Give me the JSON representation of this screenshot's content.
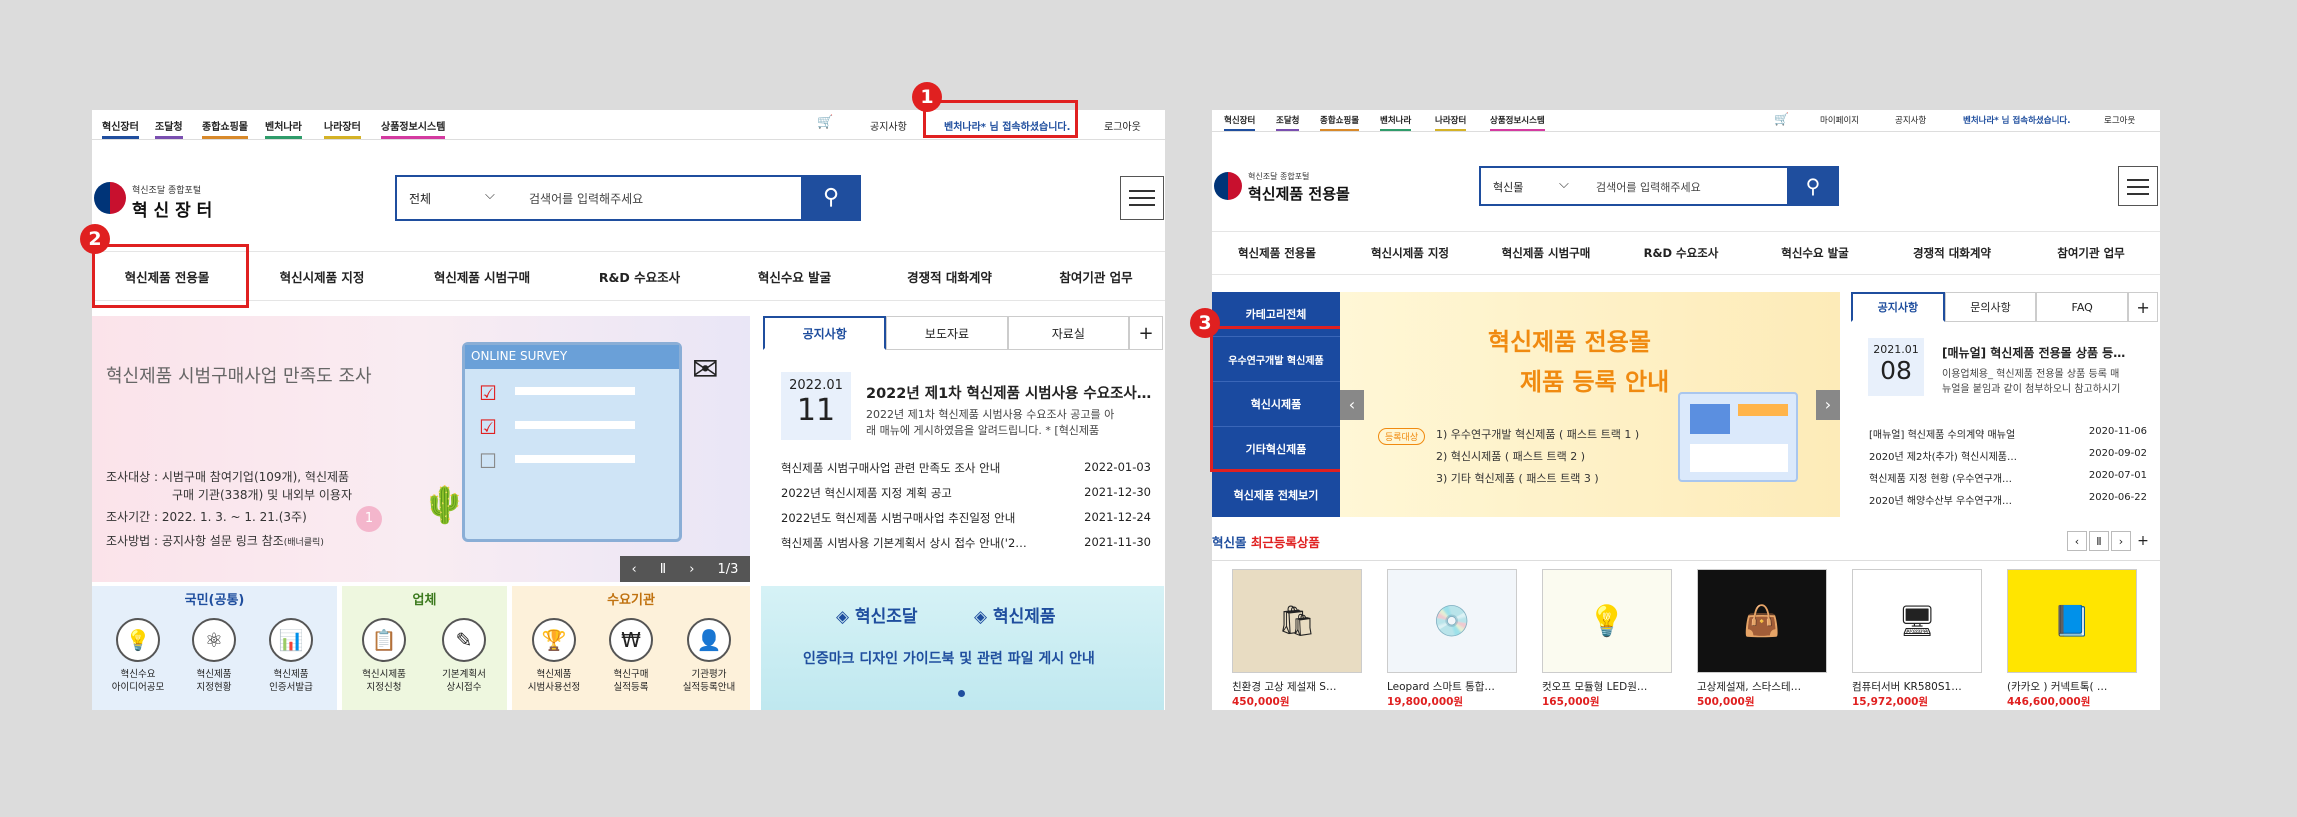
{
  "left": {
    "topnav": [
      "혁신장터",
      "조달청",
      "종합쇼핑몰",
      "벤처나라",
      "나라장터",
      "상품정보시스템"
    ],
    "topnav_colors": [
      "#1f4e9e",
      "#7a4fb0",
      "#d8892a",
      "#2f9c6b",
      "#d4b226",
      "#d43aa0"
    ],
    "cart_icon": "cart-icon",
    "notice": "공지사항",
    "user_greeting": "벤처나라* 님 접속하셨습니다.",
    "logout": "로그아웃",
    "logo_sub": "혁신조달 종합포털",
    "logo_main": "혁 신 장 터",
    "search": {
      "select": "전체",
      "placeholder": "검색어를 입력해주세요"
    },
    "nav": [
      "혁신제품 전용몰",
      "혁신시제품 지정",
      "혁신제품 시범구매",
      "R&D 수요조사",
      "혁신수요 발굴",
      "경쟁적 대화계약",
      "참여기관 업무"
    ],
    "banner": {
      "title": "혁신제품 시범구매사업 만족도 조사",
      "survey": "ONLINE SURVEY",
      "line1": "조사대상 : 시범구매 참여기업(109개), 혁신제품",
      "line1b": "구매 기관(338개) 및 내외부 이용자",
      "line2": "조사기간 : 2022. 1. 3. ~ 1. 21.(3주)",
      "line3": "조사방법 : 공지사항 설문 링크 참조",
      "line3s": "(배너클릭)",
      "pager": "1/3"
    },
    "tabs": [
      "공지사항",
      "보도자료",
      "자료실",
      "+"
    ],
    "featured": {
      "ym": "2022.01",
      "day": "11",
      "title": "2022년 제1차 혁신제품 시범사용 수요조사…",
      "desc1": "2022년 제1차 혁신제품 시범사용 수요조사 공고를 아",
      "desc2": "래 매뉴에 게시하였음을 알려드립니다. * [혁신제품"
    },
    "news": [
      {
        "t": "혁신제품 시범구매사업 관련 만족도 조사 안내",
        "d": "2022-01-03"
      },
      {
        "t": "2022년 혁신시제품 지정 계획 공고",
        "d": "2021-12-30"
      },
      {
        "t": "2022년도 혁신제품 시범구매사업 추진일정 안내",
        "d": "2021-12-24"
      },
      {
        "t": "혁신제품 시범사용 기본계획서 상시 접수 안내('2…",
        "d": "2021-11-30"
      }
    ],
    "cats": [
      {
        "h": "국민(공통)",
        "items": [
          [
            "혁신수요",
            "아이디어공모"
          ],
          [
            "혁신제품",
            "지정현황"
          ],
          [
            "혁신제품",
            "인증서발급"
          ]
        ]
      },
      {
        "h": "업체",
        "items": [
          [
            "혁신시제품",
            "지정신청"
          ],
          [
            "기본계획서",
            "상시접수"
          ]
        ]
      },
      {
        "h": "수요기관",
        "items": [
          [
            "혁신제품",
            "시범사용선정"
          ],
          [
            "혁신구매",
            "실적등록"
          ],
          [
            "기관평가",
            "실적등록안내"
          ]
        ]
      }
    ],
    "cat_icons": [
      "bulb-icon",
      "atom-icon",
      "certificate-icon",
      "clipboard-icon",
      "edit-icon",
      "trophy-icon",
      "coin-icon",
      "person-icon"
    ],
    "promo": {
      "brand1": "혁신조달",
      "brand2": "혁신제품",
      "text": "인증마크 디자인 가이드북 및 관련 파일 게시 안내"
    },
    "markers": [
      "1",
      "2"
    ]
  },
  "right": {
    "topnav": [
      "혁신장터",
      "조달청",
      "종합쇼핑몰",
      "벤처나라",
      "나라장터",
      "상품정보시스템"
    ],
    "mypage": "마이페이지",
    "notice": "공지사항",
    "user_greeting": "벤처나라* 님 접속하셨습니다.",
    "logout": "로그아웃",
    "logo_sub": "혁신조달 종합포털",
    "logo_main": "혁신제품 전용몰",
    "search": {
      "select": "혁신몰",
      "placeholder": "검색어를 입력해주세요"
    },
    "nav": [
      "혁신제품 전용몰",
      "혁신시제품 지정",
      "혁신제품 시범구매",
      "R&D 수요조사",
      "혁신수요 발굴",
      "경쟁적 대화계약",
      "참여기관 업무"
    ],
    "side": [
      "카테고리전체",
      "우수연구개발 혁신제품",
      "혁신시제품",
      "기타혁신제품",
      "혁신제품 전체보기"
    ],
    "banner": {
      "title1": "혁신제품 전용몰",
      "title2": "제품 등록 안내",
      "tag": "등록대상",
      "l1": "1) 우수연구개발 혁신제품 ( 패스트 트랙 1 )",
      "l2": "2) 혁신시제품 ( 패스트 트랙 2 )",
      "l3": "3) 기타 혁신제품 ( 패스트 트랙 3 )"
    },
    "tabs": [
      "공지사항",
      "문의사항",
      "FAQ",
      "+"
    ],
    "featured": {
      "ym": "2021.01",
      "day": "08",
      "title": "[매뉴얼] 혁신제품 전용몰 상품 등…",
      "desc1": "이용업체용_ 혁신제품 전용몰 상품 등록 매",
      "desc2": "뉴얼을 붙임과 같이 첨부하오니 참고하시기"
    },
    "news": [
      {
        "t": "[매뉴얼] 혁신제품 수의계약 매뉴얼",
        "d": "2020-11-06"
      },
      {
        "t": "2020년 제2차(추가) 혁신시제품…",
        "d": "2020-09-02"
      },
      {
        "t": "혁신제품 지정 현황 (우수연구개…",
        "d": "2020-07-01"
      },
      {
        "t": "2020년 해양수산부 우수연구개…",
        "d": "2020-06-22"
      }
    ],
    "recent_prefix": "혁신몰",
    "recent_suffix": "최근등록상품",
    "products": [
      {
        "n": "친환경 고상 제설재 S…",
        "p": "450,000원",
        "icon": "sack-icon"
      },
      {
        "n": "Leopard 스마트 통합…",
        "p": "19,800,000원",
        "icon": "software-box-icon"
      },
      {
        "n": "컷오프 모듈형 LED원…",
        "p": "165,000원",
        "icon": "led-module-icon"
      },
      {
        "n": "고상제설재, 스타스테…",
        "p": "500,000원",
        "icon": "bag-icon"
      },
      {
        "n": "컴퓨터서버 KR580S1…",
        "p": "15,972,000원",
        "icon": "server-icon"
      },
      {
        "n": "(카카오 ) 커넥트톡( …",
        "p": "446,600,000원",
        "icon": "kakao-book-icon"
      }
    ],
    "marker": "3"
  }
}
